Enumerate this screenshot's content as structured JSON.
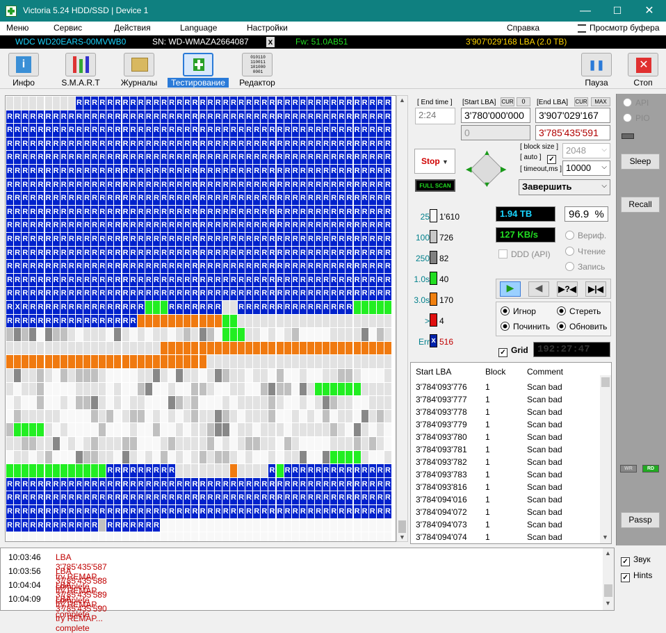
{
  "titlebar": {
    "title": "Victoria 5.24 HDD/SSD | Device 1",
    "minimize": "—",
    "maximize": "☐",
    "close": "✕"
  },
  "menu": {
    "items": [
      "Меню",
      "Сервис",
      "Действия",
      "Language",
      "Настройки",
      "Справка"
    ],
    "clipboard": "Просмотр буфера"
  },
  "device": {
    "model": "WDC WD20EARS-00MVWB0",
    "serial": "SN: WD-WMAZA2664087",
    "x": "x",
    "firmware": "Fw: 51.0AB51",
    "capacity": "3'907'029'168 LBA (2.0 TB)"
  },
  "toolbar": {
    "info": "Инфо",
    "smart": "S.M.A.R.T",
    "journals": "Журналы",
    "testing": "Тестирование",
    "editor": "Редактор",
    "pause": "Пауза",
    "stop": "Стоп",
    "pause_glyph": "❚❚",
    "stop_glyph": "✕",
    "info_glyph": "i",
    "editor_glyph": "010110 110011 101000 0001"
  },
  "scan": {
    "end_time_label": "[ End time ]",
    "end_time_value": "2:24",
    "start_lba_label": "[Start LBA]",
    "cur_label": "CUR",
    "cur_value": "0",
    "end_lba_label": "[End LBA]",
    "cur2_label": "CUR",
    "max_label": "MAX",
    "start_lba": "3'780'000'000",
    "end_lba": "3'907'029'167",
    "position_lba": "0",
    "current_lba": "3'785'435'591",
    "stop_button": "Stop",
    "full_scan": "FULL SCAN",
    "block_size_label": "[ block size ]",
    "auto_label": "[ auto ]",
    "block_size_value": "2048",
    "timeout_label": "[ timeout,ms ]",
    "timeout_value": "10000",
    "finish_action": "Завершить"
  },
  "legend": [
    {
      "label": "25",
      "count": "1'610",
      "color": "#f8f8f8"
    },
    {
      "label": "100",
      "count": "726",
      "color": "#c8c8c8"
    },
    {
      "label": "250",
      "count": "82",
      "color": "#808080"
    },
    {
      "label": "1.0s",
      "count": "40",
      "color": "#22dd22"
    },
    {
      "label": "3.0s",
      "count": "170",
      "color": "#f08010"
    },
    {
      "label": ">",
      "count": "4",
      "color": "#e01010"
    },
    {
      "label": "Err",
      "count": "516",
      "color": "#0022aa",
      "mark": "x"
    }
  ],
  "stats": {
    "processed": "1.94 TB",
    "percent": "96.9",
    "percent_sign": "%",
    "speed": "127 KB/s",
    "ddd": "DDD (API)",
    "verify": "Вериф.",
    "read": "Чтение",
    "write": "Запись",
    "ignore": "Игнор",
    "erase": "Стереть",
    "repair": "Починить",
    "refresh": "Обновить",
    "grid": "Grid",
    "timer": "192:27:47"
  },
  "right_panel": {
    "api": "API",
    "pio": "PIO",
    "sleep": "Sleep",
    "recall": "Recall",
    "wr": "WR",
    "rd": "RD",
    "passp": "Passp",
    "sound": "Звук",
    "hints": "Hints"
  },
  "lba_table": {
    "headers": [
      "Start LBA",
      "Block",
      "Comment"
    ],
    "rows": [
      [
        "3'784'093'776",
        "1",
        "Scan bad"
      ],
      [
        "3'784'093'777",
        "1",
        "Scan bad"
      ],
      [
        "3'784'093'778",
        "1",
        "Scan bad"
      ],
      [
        "3'784'093'779",
        "1",
        "Scan bad"
      ],
      [
        "3'784'093'780",
        "1",
        "Scan bad"
      ],
      [
        "3'784'093'781",
        "1",
        "Scan bad"
      ],
      [
        "3'784'093'782",
        "1",
        "Scan bad"
      ],
      [
        "3'784'093'783",
        "1",
        "Scan bad"
      ],
      [
        "3'784'093'816",
        "1",
        "Scan bad"
      ],
      [
        "3'784'094'016",
        "1",
        "Scan bad"
      ],
      [
        "3'784'094'072",
        "1",
        "Scan bad"
      ],
      [
        "3'784'094'073",
        "1",
        "Scan bad"
      ],
      [
        "3'784'094'074",
        "1",
        "Scan bad"
      ]
    ]
  },
  "log": [
    {
      "time": "10:03:46",
      "msg": "LBA 3'785'435'587 try REMAP... complete"
    },
    {
      "time": "10:03:56",
      "msg": "LBA 3'785'435'588 try REMAP... complete"
    },
    {
      "time": "10:04:04",
      "msg": "LBA 3'785'435'589 try REMAP... complete"
    },
    {
      "time": "10:04:09",
      "msg": "LBA 3'785'435'590 try REMAP... complete"
    }
  ],
  "scan_map": {
    "legend_key": "B=bad/remapped R, X=error, W=light, L=light gray, G=gray, D=dark gray, g=green, o=orange, r=red",
    "rows": [
      "LLLLLLLLLLLLLLLLLLLLLLLLLLLLLLLLLLLLLLLLLLLLLLLLLLLLLLLLLLLLLLLLLLLLLLLLLLLLLLLLLLLLLLLLLLLLLLLLLLLLLLLLLL",
      "RRRRRRRRRRRRRRRRRRRRRRRRRRRRRRRRRRRRRRRRRRRRRRRRRRRRRRRRRR"
    ]
  }
}
